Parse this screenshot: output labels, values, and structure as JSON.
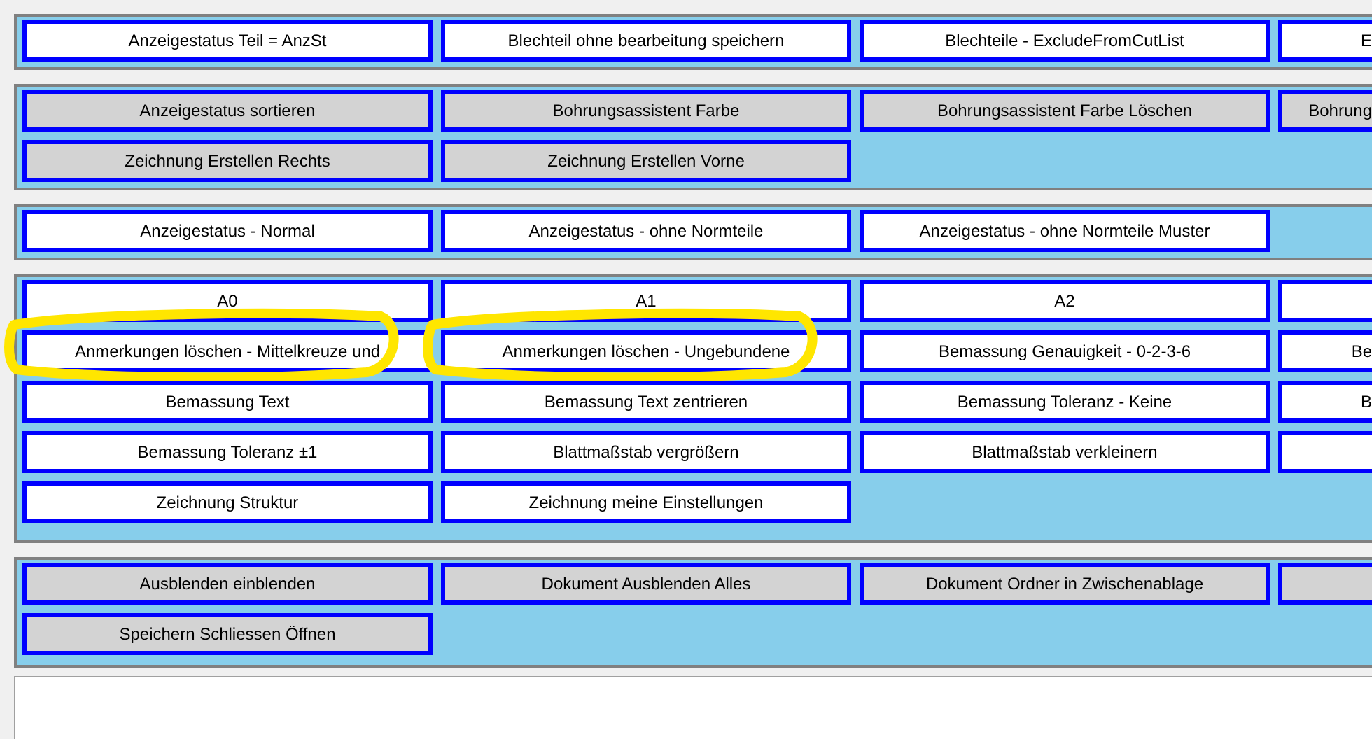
{
  "panels": [
    {
      "shaded": false,
      "buttons": [
        {
          "label": "Anzeigestatus Teil = AnzSt",
          "kind": "full",
          "highlighted": false
        },
        {
          "label": "Blechteil ohne bearbeitung speichern",
          "kind": "full",
          "highlighted": false
        },
        {
          "label": "Blechteile - ExcludeFromCutList",
          "kind": "full",
          "highlighted": false
        },
        {
          "label": "E",
          "kind": "partial",
          "highlighted": false
        }
      ]
    },
    {
      "shaded": true,
      "buttons": [
        {
          "label": "Anzeigestatus sortieren",
          "kind": "full",
          "highlighted": false
        },
        {
          "label": "Bohrungsassistent Farbe",
          "kind": "full",
          "highlighted": false
        },
        {
          "label": "Bohrungsassistent Farbe Löschen",
          "kind": "full",
          "highlighted": false
        },
        {
          "label": "Bohrung",
          "kind": "partial",
          "highlighted": false
        },
        {
          "label": "Zeichnung Erstellen Rechts",
          "kind": "full",
          "highlighted": false
        },
        {
          "label": "Zeichnung Erstellen Vorne",
          "kind": "full",
          "highlighted": false
        }
      ]
    },
    {
      "shaded": false,
      "buttons": [
        {
          "label": "Anzeigestatus - Normal",
          "kind": "full",
          "highlighted": false
        },
        {
          "label": "Anzeigestatus - ohne Normteile",
          "kind": "full",
          "highlighted": false
        },
        {
          "label": "Anzeigestatus - ohne Normteile Muster",
          "kind": "full",
          "highlighted": false
        }
      ]
    },
    {
      "shaded": false,
      "buttons": [
        {
          "label": "A0",
          "kind": "full",
          "highlighted": false
        },
        {
          "label": "A1",
          "kind": "full",
          "highlighted": false
        },
        {
          "label": "A2",
          "kind": "full",
          "highlighted": false
        },
        {
          "kind": "partial",
          "highlighted": false
        },
        {
          "label": "Anmerkungen löschen - Mittelkreuze und",
          "kind": "full",
          "highlighted": true
        },
        {
          "label": "Anmerkungen löschen - Ungebundene",
          "kind": "full",
          "highlighted": true
        },
        {
          "label": "Bemassung Genauigkeit - 0-2-3-6",
          "kind": "full",
          "highlighted": false
        },
        {
          "label": "Be",
          "kind": "partial",
          "highlighted": false
        },
        {
          "label": "Bemassung Text",
          "kind": "full",
          "highlighted": false
        },
        {
          "label": "Bemassung Text zentrieren",
          "kind": "full",
          "highlighted": false
        },
        {
          "label": "Bemassung Toleranz - Keine",
          "kind": "full",
          "highlighted": false
        },
        {
          "label": "B",
          "kind": "partial",
          "highlighted": false
        },
        {
          "label": "Bemassung Toleranz ±1",
          "kind": "full",
          "highlighted": false
        },
        {
          "label": "Blattmaßstab  vergrößern",
          "kind": "full",
          "highlighted": false
        },
        {
          "label": "Blattmaßstab  verkleinern",
          "kind": "full",
          "highlighted": false
        },
        {
          "kind": "partial",
          "highlighted": false
        },
        {
          "label": "Zeichnung Struktur",
          "kind": "full",
          "highlighted": false
        },
        {
          "label": "Zeichnung meine Einstellungen",
          "kind": "full",
          "highlighted": false
        }
      ]
    },
    {
      "shaded": true,
      "buttons": [
        {
          "label": "Ausblenden einblenden",
          "kind": "full",
          "highlighted": false
        },
        {
          "label": "Dokument Ausblenden Alles",
          "kind": "full",
          "highlighted": false
        },
        {
          "label": "Dokument Ordner in Zwischenablage",
          "kind": "full",
          "highlighted": false
        },
        {
          "kind": "partial",
          "highlighted": false
        },
        {
          "label": "Speichern Schliessen Öffnen",
          "kind": "full",
          "highlighted": false
        }
      ]
    }
  ]
}
